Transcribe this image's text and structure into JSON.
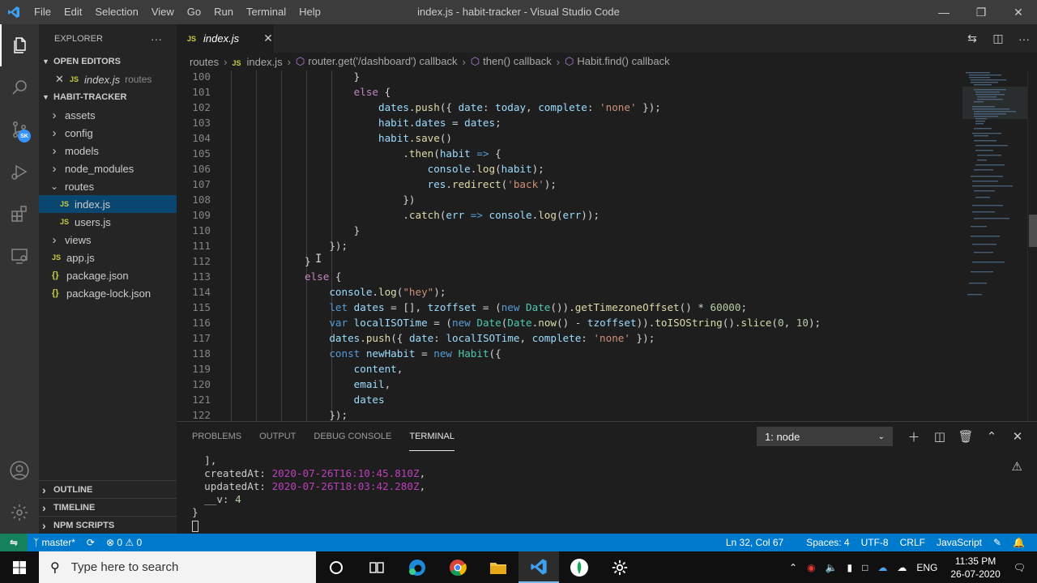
{
  "window": {
    "title": "index.js - habit-tracker - Visual Studio Code",
    "menu": [
      "File",
      "Edit",
      "Selection",
      "View",
      "Go",
      "Run",
      "Terminal",
      "Help"
    ]
  },
  "activity": {
    "account_badge": "SK"
  },
  "sidebar": {
    "header": "EXPLORER",
    "more": "···",
    "open_editors": {
      "title": "OPEN EDITORS",
      "items": [
        {
          "badge": "JS",
          "name": "index.js",
          "folder": "routes"
        }
      ]
    },
    "project": {
      "title": "HABIT-TRACKER",
      "items": [
        {
          "type": "folder",
          "name": "assets",
          "open": false
        },
        {
          "type": "folder",
          "name": "config",
          "open": false
        },
        {
          "type": "folder",
          "name": "models",
          "open": false
        },
        {
          "type": "folder",
          "name": "node_modules",
          "open": false
        },
        {
          "type": "folder",
          "name": "routes",
          "open": true
        },
        {
          "type": "js",
          "name": "index.js",
          "selected": true,
          "indent": 1
        },
        {
          "type": "js",
          "name": "users.js",
          "indent": 1
        },
        {
          "type": "folder",
          "name": "views",
          "open": false
        },
        {
          "type": "js",
          "name": "app.js"
        },
        {
          "type": "json",
          "name": "package.json"
        },
        {
          "type": "json",
          "name": "package-lock.json"
        }
      ]
    },
    "bottom_sections": [
      "OUTLINE",
      "TIMELINE",
      "NPM SCRIPTS"
    ]
  },
  "tab": {
    "badge": "JS",
    "name": "index.js",
    "close": "✕"
  },
  "breadcrumb": [
    "routes",
    "index.js",
    "router.get('/dashboard') callback",
    "then() callback",
    "Habit.find() callback"
  ],
  "code": {
    "lines": [
      {
        "n": "100",
        "indent": 24,
        "tokens": [
          [
            "p",
            "}"
          ]
        ]
      },
      {
        "n": "101",
        "indent": 24,
        "tokens": [
          [
            "ctrl",
            "else"
          ],
          [
            "p",
            " {"
          ]
        ]
      },
      {
        "n": "102",
        "indent": 28,
        "tokens": [
          [
            "var",
            "dates"
          ],
          [
            "p",
            "."
          ],
          [
            "fn",
            "push"
          ],
          [
            "p",
            "({ "
          ],
          [
            "var",
            "date"
          ],
          [
            "p",
            ": "
          ],
          [
            "var",
            "today"
          ],
          [
            "p",
            ", "
          ],
          [
            "var",
            "complete"
          ],
          [
            "p",
            ": "
          ],
          [
            "str",
            "'none'"
          ],
          [
            "p",
            " });"
          ]
        ]
      },
      {
        "n": "103",
        "indent": 28,
        "tokens": [
          [
            "var",
            "habit"
          ],
          [
            "p",
            "."
          ],
          [
            "var",
            "dates"
          ],
          [
            "p",
            " = "
          ],
          [
            "var",
            "dates"
          ],
          [
            "p",
            ";"
          ]
        ]
      },
      {
        "n": "104",
        "indent": 28,
        "tokens": [
          [
            "var",
            "habit"
          ],
          [
            "p",
            "."
          ],
          [
            "fn",
            "save"
          ],
          [
            "p",
            "()"
          ]
        ]
      },
      {
        "n": "105",
        "indent": 32,
        "tokens": [
          [
            "p",
            "."
          ],
          [
            "fn",
            "then"
          ],
          [
            "p",
            "("
          ],
          [
            "var",
            "habit"
          ],
          [
            "p",
            " "
          ],
          [
            "kw",
            "=>"
          ],
          [
            "p",
            " {"
          ]
        ]
      },
      {
        "n": "106",
        "indent": 36,
        "tokens": [
          [
            "var",
            "console"
          ],
          [
            "p",
            "."
          ],
          [
            "fn",
            "log"
          ],
          [
            "p",
            "("
          ],
          [
            "var",
            "habit"
          ],
          [
            "p",
            ");"
          ]
        ]
      },
      {
        "n": "107",
        "indent": 36,
        "tokens": [
          [
            "var",
            "res"
          ],
          [
            "p",
            "."
          ],
          [
            "fn",
            "redirect"
          ],
          [
            "p",
            "("
          ],
          [
            "str",
            "'back'"
          ],
          [
            "p",
            ");"
          ]
        ]
      },
      {
        "n": "108",
        "indent": 32,
        "tokens": [
          [
            "p",
            "})"
          ]
        ]
      },
      {
        "n": "109",
        "indent": 32,
        "tokens": [
          [
            "p",
            "."
          ],
          [
            "fn",
            "catch"
          ],
          [
            "p",
            "("
          ],
          [
            "var",
            "err"
          ],
          [
            "p",
            " "
          ],
          [
            "kw",
            "=>"
          ],
          [
            "p",
            " "
          ],
          [
            "var",
            "console"
          ],
          [
            "p",
            "."
          ],
          [
            "fn",
            "log"
          ],
          [
            "p",
            "("
          ],
          [
            "var",
            "err"
          ],
          [
            "p",
            "));"
          ]
        ]
      },
      {
        "n": "110",
        "indent": 24,
        "tokens": [
          [
            "p",
            "}"
          ]
        ]
      },
      {
        "n": "111",
        "indent": 20,
        "tokens": [
          [
            "p",
            "});"
          ]
        ]
      },
      {
        "n": "112",
        "indent": 16,
        "tokens": [
          [
            "p",
            "}"
          ]
        ]
      },
      {
        "n": "113",
        "indent": 16,
        "tokens": [
          [
            "ctrl",
            "else"
          ],
          [
            "p",
            " {"
          ]
        ]
      },
      {
        "n": "114",
        "indent": 20,
        "tokens": [
          [
            "var",
            "console"
          ],
          [
            "p",
            "."
          ],
          [
            "fn",
            "log"
          ],
          [
            "p",
            "("
          ],
          [
            "str",
            "\"hey\""
          ],
          [
            "p",
            ");"
          ]
        ]
      },
      {
        "n": "115",
        "indent": 20,
        "tokens": [
          [
            "kw",
            "let"
          ],
          [
            "p",
            " "
          ],
          [
            "var",
            "dates"
          ],
          [
            "p",
            " = [], "
          ],
          [
            "var",
            "tzoffset"
          ],
          [
            "p",
            " = ("
          ],
          [
            "kw",
            "new"
          ],
          [
            "p",
            " "
          ],
          [
            "cls",
            "Date"
          ],
          [
            "p",
            "())."
          ],
          [
            "fn",
            "getTimezoneOffset"
          ],
          [
            "p",
            "() * "
          ],
          [
            "num",
            "60000"
          ],
          [
            "p",
            ";"
          ]
        ]
      },
      {
        "n": "116",
        "indent": 20,
        "tokens": [
          [
            "kw",
            "var"
          ],
          [
            "p",
            " "
          ],
          [
            "var",
            "localISOTime"
          ],
          [
            "p",
            " = ("
          ],
          [
            "kw",
            "new"
          ],
          [
            "p",
            " "
          ],
          [
            "cls",
            "Date"
          ],
          [
            "p",
            "("
          ],
          [
            "cls",
            "Date"
          ],
          [
            "p",
            "."
          ],
          [
            "fn",
            "now"
          ],
          [
            "p",
            "() - "
          ],
          [
            "var",
            "tzoffset"
          ],
          [
            "p",
            "))."
          ],
          [
            "fn",
            "toISOString"
          ],
          [
            "p",
            "()."
          ],
          [
            "fn",
            "slice"
          ],
          [
            "p",
            "("
          ],
          [
            "num",
            "0"
          ],
          [
            "p",
            ", "
          ],
          [
            "num",
            "10"
          ],
          [
            "p",
            ");"
          ]
        ]
      },
      {
        "n": "117",
        "indent": 20,
        "tokens": [
          [
            "var",
            "dates"
          ],
          [
            "p",
            "."
          ],
          [
            "fn",
            "push"
          ],
          [
            "p",
            "({ "
          ],
          [
            "var",
            "date"
          ],
          [
            "p",
            ": "
          ],
          [
            "var",
            "localISOTime"
          ],
          [
            "p",
            ", "
          ],
          [
            "var",
            "complete"
          ],
          [
            "p",
            ": "
          ],
          [
            "str",
            "'none'"
          ],
          [
            "p",
            " });"
          ]
        ]
      },
      {
        "n": "118",
        "indent": 20,
        "tokens": [
          [
            "kw",
            "const"
          ],
          [
            "p",
            " "
          ],
          [
            "var",
            "newHabit"
          ],
          [
            "p",
            " = "
          ],
          [
            "kw",
            "new"
          ],
          [
            "p",
            " "
          ],
          [
            "cls",
            "Habit"
          ],
          [
            "p",
            "({"
          ]
        ]
      },
      {
        "n": "119",
        "indent": 24,
        "tokens": [
          [
            "var",
            "content"
          ],
          [
            "p",
            ","
          ]
        ]
      },
      {
        "n": "120",
        "indent": 24,
        "tokens": [
          [
            "var",
            "email"
          ],
          [
            "p",
            ","
          ]
        ]
      },
      {
        "n": "121",
        "indent": 24,
        "tokens": [
          [
            "var",
            "dates"
          ]
        ]
      },
      {
        "n": "122",
        "indent": 20,
        "tokens": [
          [
            "p",
            "});"
          ]
        ]
      }
    ]
  },
  "panel": {
    "tabs": [
      "PROBLEMS",
      "OUTPUT",
      "DEBUG CONSOLE",
      "TERMINAL"
    ],
    "active_tab": "TERMINAL",
    "terminal_select": "1: node",
    "terminal_lines": [
      {
        "pre": "  ],",
        "val": "",
        "post": "",
        "kind": ""
      },
      {
        "pre": "  createdAt: ",
        "val": "2020-07-26T16:10:45.810Z",
        "post": ",",
        "kind": "date"
      },
      {
        "pre": "  updatedAt: ",
        "val": "2020-07-26T18:03:42.280Z",
        "post": ",",
        "kind": "date"
      },
      {
        "pre": "  __v: ",
        "val": "4",
        "post": "",
        "kind": "n"
      },
      {
        "pre": "}",
        "val": "",
        "post": "",
        "kind": ""
      }
    ]
  },
  "status": {
    "branch": "master*",
    "errors": "0",
    "warnings": "0",
    "position": "Ln 32, Col 67",
    "spaces": "Spaces: 4",
    "encoding": "UTF-8",
    "eol": "CRLF",
    "language": "JavaScript"
  },
  "taskbar": {
    "search_placeholder": "Type here to search",
    "lang": "ENG",
    "time": "11:35 PM",
    "date": "26-07-2020"
  }
}
